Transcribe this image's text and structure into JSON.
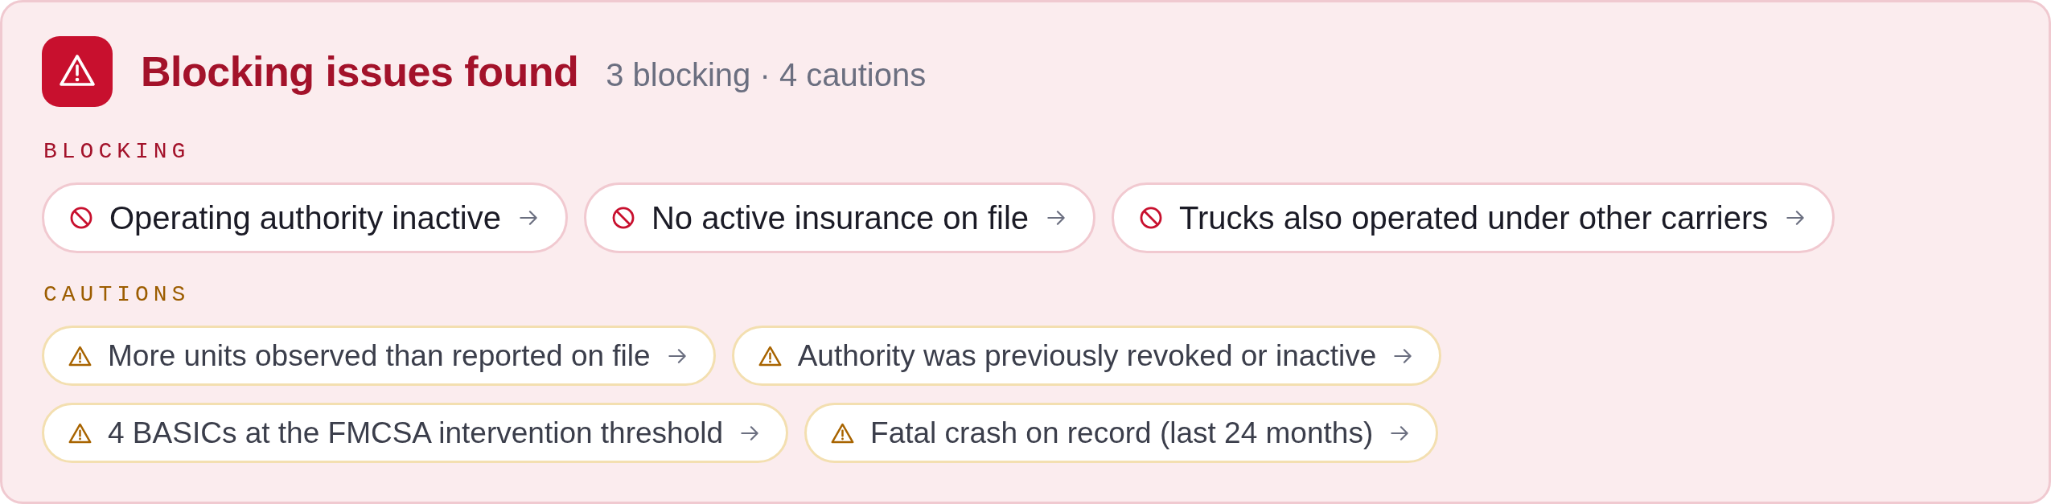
{
  "header": {
    "title": "Blocking issues found",
    "summary": "3 blocking · 4 cautions"
  },
  "groups": [
    {
      "kind": "blocking",
      "label": "BLOCKING",
      "issues": [
        {
          "text": "Operating authority inactive"
        },
        {
          "text": "No active insurance on file"
        },
        {
          "text": "Trucks also operated under other carriers"
        }
      ]
    },
    {
      "kind": "caution",
      "label": "CAUTIONS",
      "issues": [
        {
          "text": "More units observed than reported on file"
        },
        {
          "text": "Authority was previously revoked or inactive"
        },
        {
          "text": "4 BASICs at the FMCSA intervention threshold"
        },
        {
          "text": "Fatal crash on record (last 24 months)"
        }
      ]
    }
  ]
}
